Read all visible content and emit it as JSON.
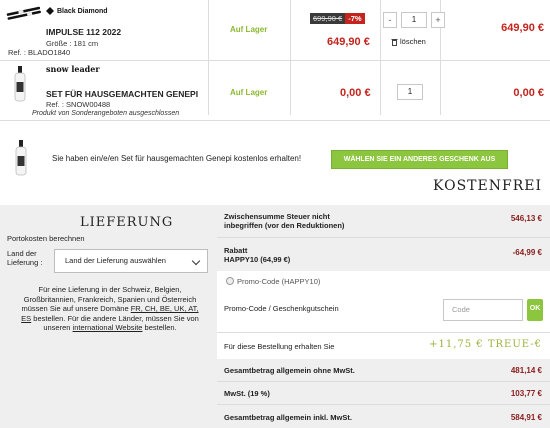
{
  "products": [
    {
      "brand": "Black Diamond",
      "name": "IMPULSE 112 2022",
      "size_label": "Größe :",
      "size_value": "181 cm",
      "ref_label": "Ref. :",
      "ref_value": "BLADO1840",
      "stock": "Auf Lager",
      "old_price": "699,90 €",
      "discount": "-7%",
      "unit_price": "649,90 €",
      "quantity": "1",
      "remove_label": "löschen",
      "total": "649,90 €"
    },
    {
      "brand": "snow leader",
      "name": "SET FÜR HAUSGEMACHTEN GENEPI",
      "ref_label": "Ref. :",
      "ref_value": "SNOW00488",
      "note": "Produkt von Sonderangeboten ausgeschlossen",
      "stock": "Auf Lager",
      "unit_price": "0,00 €",
      "quantity": "1",
      "total": "0,00 €"
    }
  ],
  "gift": {
    "message": "Sie haben ein/e/en Set für hausgemachten Genepi kostenlos erhalten!",
    "button": "WÄHLEN SIE EIN ANDERES GESCHENK AUS",
    "free_label": "KOSTENFREI"
  },
  "delivery": {
    "title": "LIEFERUNG",
    "shipping_costs": "Portokosten berechnen",
    "country_label_1": "Land der",
    "country_label_2": "Lieferung :",
    "country_select": "Land der Lieferung auswählen",
    "info_1": "Für eine Lieferung in der Schweiz, Belgien,",
    "info_2": "Großbritannien, Frankreich, Spanien und Österreich",
    "info_3a": "müssen Sie auf unsere Domäne",
    "info_3b": "FR, CH, BE, UK, AT,",
    "info_4a": "ES",
    "info_4b": "bestellen. Für die andere Länder, müssen Sie von",
    "info_5a": "unseren",
    "info_5b": "international Website",
    "info_5c": "bestellen."
  },
  "summary": {
    "subtotal_label_1": "Zwischensumme Steuer nicht",
    "subtotal_label_2": "inbegriffen (vor den Reduktionen)",
    "subtotal": "546,13 €",
    "discount_label": "Rabatt",
    "discount_code": "HAPPY10 (64,99 €)",
    "discount": "-64,99 €",
    "promo_applied": "Promo-Code (HAPPY10)",
    "promo_label": "Promo-Code / Geschenkgutschein",
    "promo_placeholder": "Code",
    "ok_label": "OK",
    "loyalty_label": "Für diese Bestellung erhalten Sie",
    "loyalty_value": "+11,75 € TREUE-€",
    "total_excl_label": "Gesamtbetrag allgemein ohne MwSt.",
    "total_excl": "481,14 €",
    "vat_label": "MwSt. (19 %)",
    "vat": "103,77 €",
    "total_incl_label": "Gesamtbetrag allgemein inkl. MwSt.",
    "total_incl": "584,91 €"
  },
  "colors": {
    "accent_green": "#8cc63e",
    "price_red": "#c4241d",
    "dark_red": "#8a1c1c",
    "panel_grey": "#efefef"
  }
}
